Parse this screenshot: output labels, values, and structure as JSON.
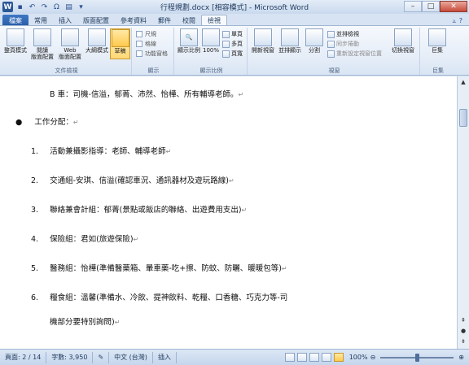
{
  "window": {
    "title": "行程規劃.docx [相容模式] - Microsoft Word",
    "app_logo": "W",
    "controls": [
      "–",
      "□",
      "✕"
    ]
  },
  "quick_access": {
    "icons": [
      "save-icon",
      "undo-icon",
      "redo-icon",
      "spelling-icon",
      "print-icon",
      "customize-icon"
    ]
  },
  "tabs": {
    "file": "檔案",
    "items": [
      "常用",
      "插入",
      "版面配置",
      "參考資料",
      "郵件",
      "校閱",
      "檢視"
    ],
    "active": "檢視"
  },
  "ribbon": {
    "doc_views": {
      "label": "文件檢視",
      "buttons": [
        {
          "label_1": "整頁模式",
          "label_2": ""
        },
        {
          "label_1": "閱讀",
          "label_2": "版面配置"
        },
        {
          "label_1": "Web",
          "label_2": "版面配置"
        },
        {
          "label_1": "大綱模式",
          "label_2": ""
        },
        {
          "label_1": "草稿",
          "label_2": ""
        }
      ]
    },
    "show": {
      "label": "顯示",
      "items": [
        "尺規",
        "格線",
        "功能窗格"
      ]
    },
    "zoom": {
      "label": "顯示比例",
      "zoom_label": "顯示比例",
      "percent_label": "100%",
      "options": [
        "單頁",
        "多頁",
        "頁寬"
      ]
    },
    "window": {
      "label": "視窗",
      "new_window": "開新視窗",
      "arrange_all": "並排顯示",
      "split": "分割",
      "side_by_side": "並排檢視",
      "sync_scroll": "同步捲動",
      "reset_position": "重新設定視窗位置",
      "switch_windows": "切換視窗"
    },
    "macros": {
      "label": "巨集",
      "button": "巨集"
    }
  },
  "document": {
    "lines": [
      {
        "text": "B 車：司機-信溢，郁菁、沛然、怡樺、所有輔導老師。",
        "mark": "↵"
      },
      {
        "bullet": "●",
        "text": "工作分配：",
        "mark": "↵"
      },
      {
        "num": "1.",
        "text": "活動兼攝影指導：老師、輔導老師",
        "mark": "↵"
      },
      {
        "num": "2.",
        "text": "交通組-安琪、信溢(確認車況、通訊器材及遊玩路線)",
        "mark": "↵"
      },
      {
        "num": "3.",
        "text": "聯絡兼會計組：郁菁(景點或飯店的聯絡、出遊費用支出)",
        "mark": "↵"
      },
      {
        "num": "4.",
        "text": "保險組：君如(旅遊保險)",
        "mark": "↵"
      },
      {
        "num": "5.",
        "text": "醫務組：怡樺(準備醫藥箱、暈車藥-吃+擦、防蚊、防曬、暖暖包等)",
        "mark": "↵"
      },
      {
        "num": "6.",
        "text": "糧食組：溫馨(準備水、冷飲、提神飲料、乾糧、口香糖、巧克力等-司",
        "mark": ""
      },
      {
        "text": "機部分要特別詢問)",
        "mark": "↵"
      }
    ]
  },
  "statusbar": {
    "page": "頁面: 2 / 14",
    "words": "字數: 3,950",
    "language": "中文 (台灣)",
    "mode": "插入",
    "zoom": "100%",
    "zoom_percent": 100
  }
}
